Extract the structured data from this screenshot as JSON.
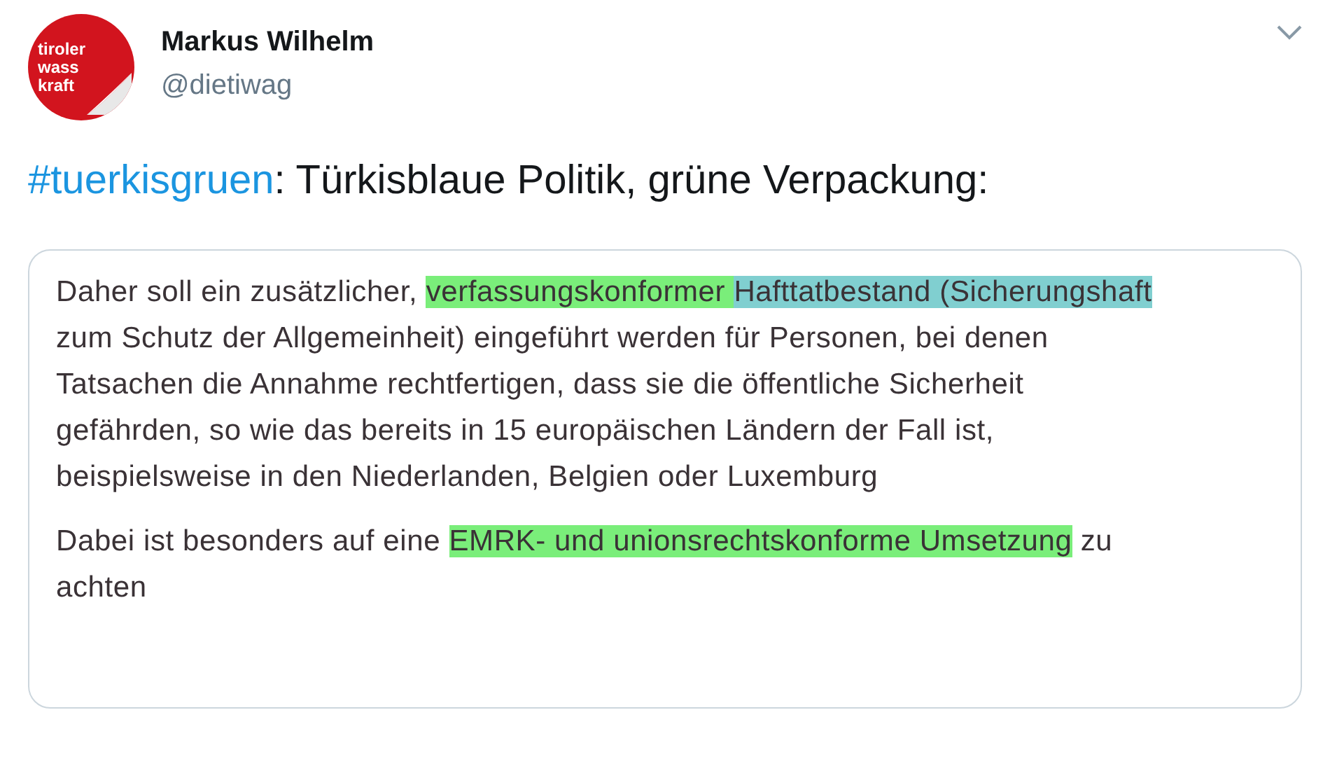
{
  "author": {
    "avatar": {
      "logo_lines": [
        "tiroler",
        "wass",
        "kraft"
      ]
    },
    "name": "Markus Wilhelm",
    "handle": "@dietiwag"
  },
  "tweet": {
    "hashtag": "#tuerkisgruen",
    "text": ": Türkisblaue Politik, grüne Verpackung:"
  },
  "document": {
    "paragraphs": [
      {
        "segments": [
          {
            "text": "Daher soll ein zusätzlicher, "
          },
          {
            "text": "verfassungskonformer ",
            "color": "#7aee7a"
          },
          {
            "text": "Hafttatbestand (Sicherungshaft",
            "color": "#80cfd0"
          },
          {
            "text": " zum Schutz der Allgemeinheit) eingeführt werden für Personen, bei denen Tatsachen die Annahme rechtfertigen, dass sie die öffentliche Sicherheit gefährden, so wie das bereits in 15 europäischen Ländern der Fall ist, beispielsweise in den Niederlanden, Belgien oder Luxemburg"
          }
        ]
      },
      {
        "segments": [
          {
            "text": "Dabei ist besonders auf eine "
          },
          {
            "text": "EMRK- und unionsrechtskonforme Umsetzung",
            "color": "#7aee7a"
          },
          {
            "text": " zu achten"
          }
        ]
      }
    ]
  }
}
